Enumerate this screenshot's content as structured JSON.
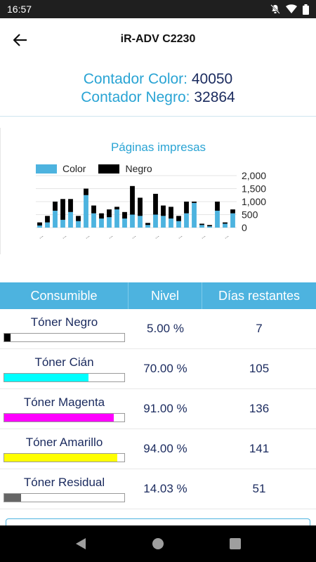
{
  "status_bar": {
    "time": "16:57"
  },
  "app_bar": {
    "title": "iR-ADV C2230"
  },
  "counters": {
    "color_label": "Contador Color:",
    "color_value": "40050",
    "black_label": "Contador Negro:",
    "black_value": "32864"
  },
  "chart_data": {
    "type": "bar",
    "title": "Páginas impresas",
    "stacked": true,
    "legend": [
      "Color",
      "Negro"
    ],
    "legend_position": "top-left",
    "y_axis_side": "right",
    "ylim": [
      0,
      2000
    ],
    "yticks": [
      "2,000",
      "1,500",
      "1,000",
      "500",
      "0"
    ],
    "tick_values": [
      2000,
      1500,
      1000,
      500,
      0
    ],
    "x_tick_label": "...",
    "series": [
      {
        "name": "Color",
        "color": "#4db3df",
        "values": [
          80,
          200,
          650,
          300,
          600,
          250,
          1250,
          550,
          350,
          400,
          700,
          350,
          500,
          450,
          100,
          500,
          450,
          350,
          250,
          550,
          950,
          100,
          50,
          650,
          150,
          550
        ]
      },
      {
        "name": "Negro",
        "color": "#000000",
        "values": [
          120,
          250,
          350,
          800,
          500,
          200,
          250,
          300,
          200,
          300,
          100,
          250,
          1100,
          700,
          80,
          800,
          400,
          450,
          200,
          450,
          50,
          50,
          50,
          350,
          50,
          150
        ]
      }
    ]
  },
  "table": {
    "headers": [
      "Consumible",
      "Nivel",
      "Días restantes"
    ],
    "rows": [
      {
        "name": "Tóner Negro",
        "level": "5.00 %",
        "days": "7",
        "fill": 0.05,
        "color": "#000000"
      },
      {
        "name": "Tóner Cián",
        "level": "70.00 %",
        "days": "105",
        "fill": 0.7,
        "color": "#00ffff"
      },
      {
        "name": "Tóner Magenta",
        "level": "91.00 %",
        "days": "136",
        "fill": 0.91,
        "color": "#ff00ff"
      },
      {
        "name": "Tóner Amarillo",
        "level": "94.00 %",
        "days": "141",
        "fill": 0.94,
        "color": "#ffff00"
      },
      {
        "name": "Tóner Residual",
        "level": "14.03 %",
        "days": "51",
        "fill": 0.1403,
        "color": "#666666"
      }
    ]
  },
  "nav": {
    "back_icon": "triangle-back-icon",
    "home_icon": "circle-home-icon",
    "recents_icon": "square-recents-icon"
  }
}
